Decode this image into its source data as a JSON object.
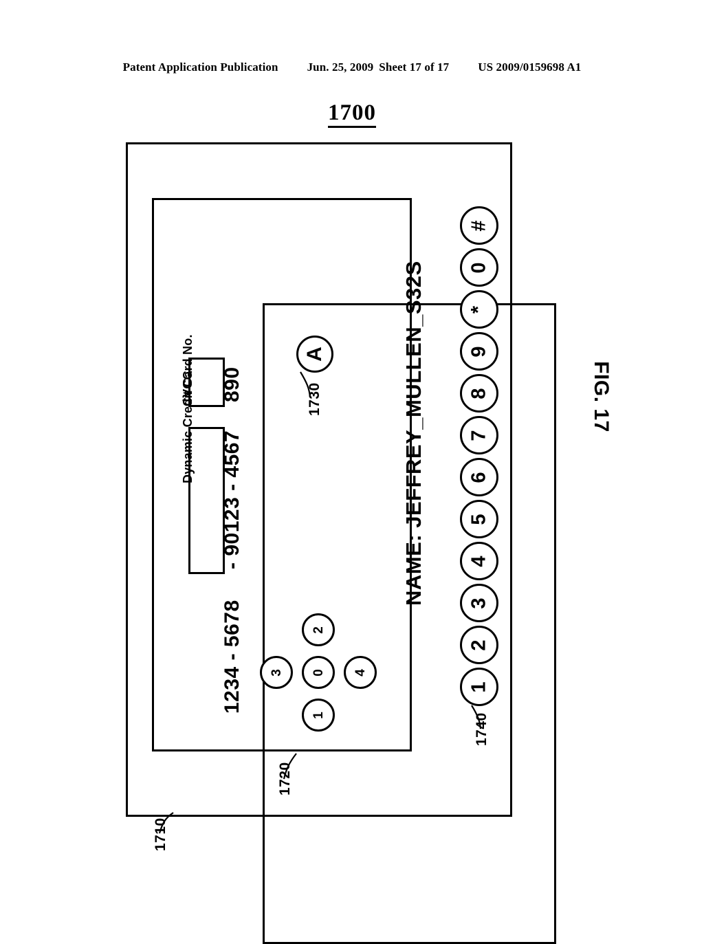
{
  "header": {
    "publication": "Patent Application Publication",
    "date": "Jun. 25, 2009",
    "sheet": "Sheet 17 of 17",
    "document_number": "US 2009/0159698 A1"
  },
  "figure": {
    "number_title": "1700",
    "caption": "FIG. 17"
  },
  "card": {
    "card_no_label": "Dynamic Credit Card No.",
    "card_no_prefix": "1234 - 5678",
    "card_no_dynamic": "- 90123 - 4567",
    "cvcc_label": "CVCC",
    "cvcc_value": "890",
    "name_line": "NAME: JEFFREY_MULLEN_S32S"
  },
  "buttons": {
    "a_button": "A",
    "dpad": {
      "center": "0",
      "up": "2",
      "down": "1",
      "left": "3",
      "right": "4"
    },
    "keypad": [
      "1",
      "2",
      "3",
      "4",
      "5",
      "6",
      "7",
      "8",
      "9",
      "*",
      "0",
      "#"
    ]
  },
  "reference_numerals": {
    "device": "1710",
    "display": "1720",
    "a_button": "1730",
    "keypad": "1740"
  },
  "colors": {
    "ink": "#000000",
    "paper": "#ffffff"
  }
}
